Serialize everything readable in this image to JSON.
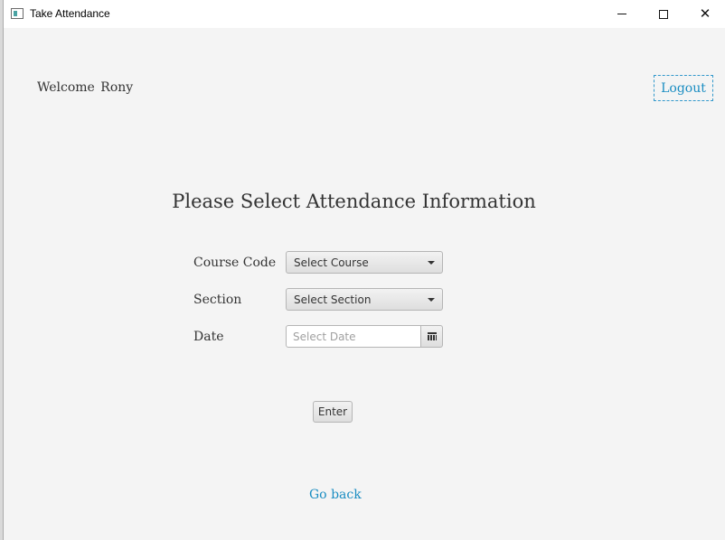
{
  "window": {
    "title": "Take Attendance",
    "minimize_icon": "minimize-icon",
    "maximize_icon": "maximize-icon",
    "close_icon": "close-icon",
    "close_glyph": "✕"
  },
  "header": {
    "welcome_text": "Welcome  Rony",
    "logout_label": "Logout"
  },
  "main": {
    "heading": "Please Select Attendance Information",
    "course_code_label": "Course Code",
    "course_selected": "Select Course",
    "section_label": "Section",
    "section_selected": "Select Section",
    "date_label": "Date",
    "date_placeholder": "Select Date",
    "calendar_icon": "calendar-icon",
    "enter_label": "Enter",
    "go_back_label": "Go back"
  },
  "colors": {
    "link": "#1a8dc2",
    "background": "#f4f4f4"
  }
}
